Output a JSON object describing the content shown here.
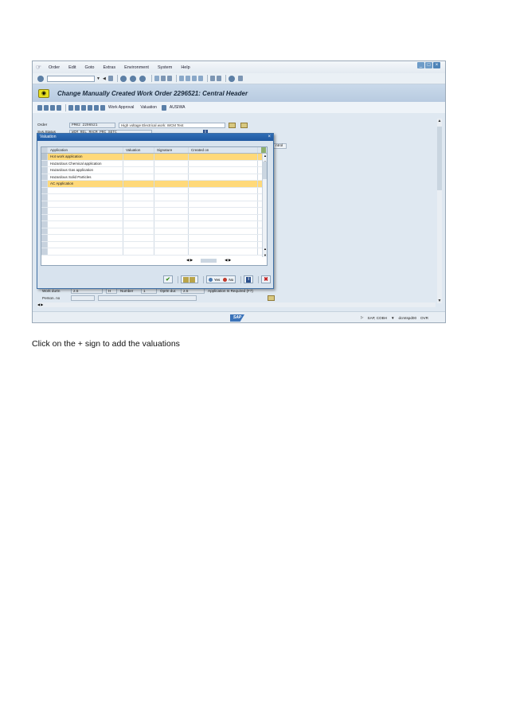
{
  "menu": [
    "Order",
    "Edit",
    "Goto",
    "Extras",
    "Environment",
    "System",
    "Help"
  ],
  "title": "Change Manually Created Work Order 2296521: Central Header",
  "app_toolbar": {
    "work_approval": "Work Approval",
    "valuation": "Valuation",
    "ausiwa": "AUSIWA"
  },
  "header": {
    "order_label": "Order",
    "order_value": "PM02 2296521",
    "order_desc": "High voltage Electrical work: WCM Test",
    "sysstatus_label": "Sys.Status",
    "sysstatus_value": "WCM  REL  MACM PRC  SETC"
  },
  "tab_label": "ntrol",
  "dialog": {
    "title": "Valuation",
    "columns": [
      "Application",
      "Valuation",
      "Signature",
      "Created on"
    ],
    "rows": [
      {
        "application": "Hot work application",
        "valuation": "",
        "signature": "",
        "created_on": ""
      },
      {
        "application": "Hazardous Chemical application",
        "valuation": "",
        "signature": "",
        "created_on": ""
      },
      {
        "application": "Hazardous Gas application",
        "valuation": "",
        "signature": "",
        "created_on": ""
      },
      {
        "application": "Hazardous Solid Particles",
        "valuation": "",
        "signature": "",
        "created_on": ""
      },
      {
        "application": "AC Application",
        "valuation": "",
        "signature": "",
        "created_on": ""
      }
    ],
    "yes_label": "Yes",
    "no_label": "No"
  },
  "lower_fields": {
    "work_label": "Work durtn",
    "work_value": "2.5",
    "unit": "H",
    "number_label": "Number",
    "number_value": "1",
    "op_dur_label": "Oprtn dur.",
    "op_dur_value": "2.5",
    "app_required": "Application Is Required (F7)",
    "person_label": "Person. no"
  },
  "status_bar": {
    "system": "SAP, COBH",
    "server": "dcmtspd00",
    "mode": "OVR"
  },
  "caption": "Click on the + sign to add the valuations"
}
